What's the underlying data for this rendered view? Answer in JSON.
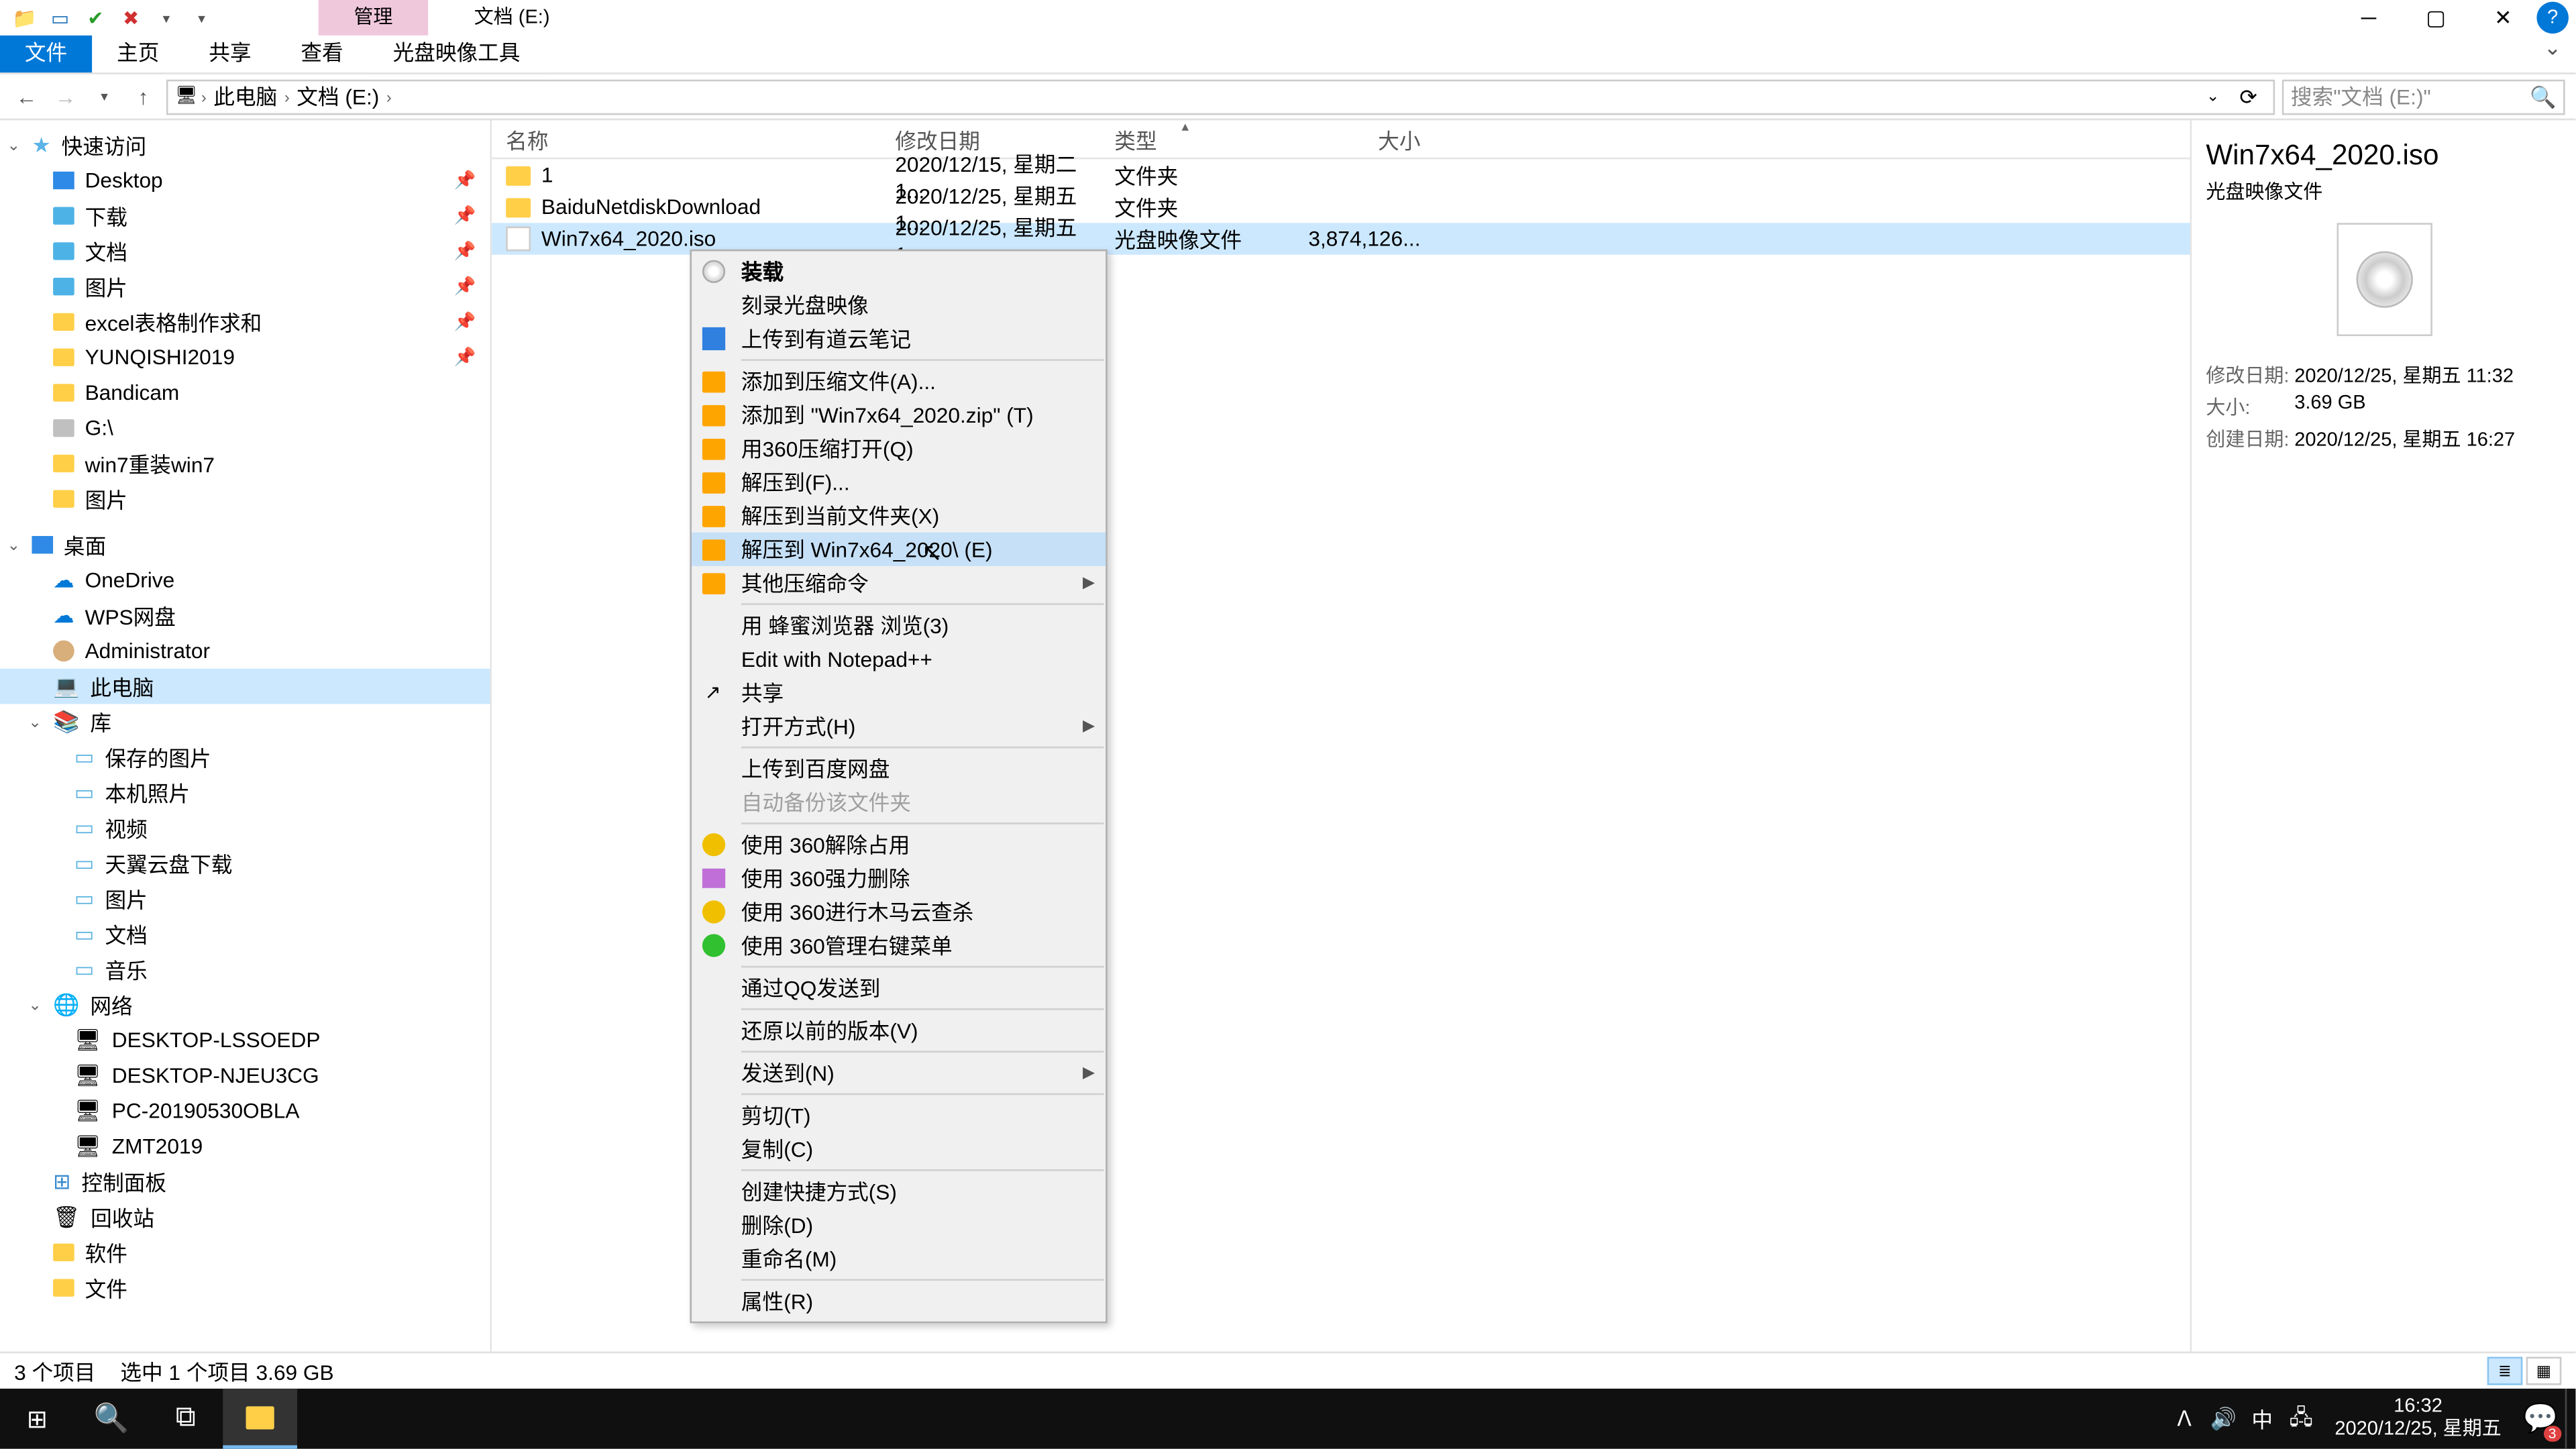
{
  "window": {
    "title": "文档 (E:)",
    "contextual_tab": "管理",
    "ribbon_tabs": [
      "文件",
      "主页",
      "共享",
      "查看",
      "光盘映像工具"
    ],
    "ribbon_selected": 0
  },
  "navigation": {
    "back_disabled": false,
    "breadcrumbs": [
      "此电脑",
      "文档 (E:)"
    ],
    "search_placeholder": "搜索\"文档 (E:)\""
  },
  "tree": {
    "quick_access": "快速访问",
    "quick_items": [
      {
        "label": "Desktop",
        "icon": "ico-desktop",
        "pinned": true
      },
      {
        "label": "下载",
        "icon": "ico-folder-blue",
        "pinned": true
      },
      {
        "label": "文档",
        "icon": "ico-folder-blue",
        "pinned": true
      },
      {
        "label": "图片",
        "icon": "ico-folder-blue",
        "pinned": true
      },
      {
        "label": "excel表格制作求和",
        "icon": "ico-folder",
        "pinned": true
      },
      {
        "label": "YUNQISHI2019",
        "icon": "ico-folder",
        "pinned": true
      },
      {
        "label": "Bandicam",
        "icon": "ico-folder",
        "pinned": false
      },
      {
        "label": "G:\\",
        "icon": "ico-disk",
        "pinned": false
      },
      {
        "label": "win7重装win7",
        "icon": "ico-folder",
        "pinned": false
      },
      {
        "label": "图片",
        "icon": "ico-folder",
        "pinned": false
      }
    ],
    "desktop": "桌面",
    "desktop_items": [
      {
        "label": "OneDrive",
        "icon": "ico-onedrive"
      },
      {
        "label": "WPS网盘",
        "icon": "ico-onedrive"
      },
      {
        "label": "Administrator",
        "icon": "ico-user"
      }
    ],
    "this_pc": "此电脑",
    "libraries": "库",
    "lib_items": [
      {
        "label": "保存的图片"
      },
      {
        "label": "本机照片"
      },
      {
        "label": "视频"
      },
      {
        "label": "天翼云盘下载"
      },
      {
        "label": "图片"
      },
      {
        "label": "文档"
      },
      {
        "label": "音乐"
      }
    ],
    "network": "网络",
    "net_items": [
      {
        "label": "DESKTOP-LSSOEDP"
      },
      {
        "label": "DESKTOP-NJEU3CG"
      },
      {
        "label": "PC-20190530OBLA"
      },
      {
        "label": "ZMT2019"
      }
    ],
    "control_panel": "控制面板",
    "recycle": "回收站",
    "software": "软件",
    "files": "文件"
  },
  "columns": {
    "name": "名称",
    "date": "修改日期",
    "type": "类型",
    "size": "大小"
  },
  "files": [
    {
      "name": "1",
      "date": "2020/12/15, 星期二 1...",
      "type": "文件夹",
      "size": "",
      "kind": "folder"
    },
    {
      "name": "BaiduNetdiskDownload",
      "date": "2020/12/25, 星期五 1...",
      "type": "文件夹",
      "size": "",
      "kind": "folder"
    },
    {
      "name": "Win7x64_2020.iso",
      "date": "2020/12/25, 星期五 1...",
      "type": "光盘映像文件",
      "size": "3,874,126...",
      "kind": "iso",
      "selected": true
    }
  ],
  "context_menu": [
    {
      "label": "装载",
      "icon": "micon-disc",
      "bold": true
    },
    {
      "label": "刻录光盘映像"
    },
    {
      "label": "上传到有道云笔记",
      "icon": "micon-note"
    },
    {
      "sep": true
    },
    {
      "label": "添加到压缩文件(A)...",
      "icon": "micon-archive"
    },
    {
      "label": "添加到 \"Win7x64_2020.zip\" (T)",
      "icon": "micon-archive"
    },
    {
      "label": "用360压缩打开(Q)",
      "icon": "micon-archive"
    },
    {
      "label": "解压到(F)...",
      "icon": "micon-archive"
    },
    {
      "label": "解压到当前文件夹(X)",
      "icon": "micon-archive"
    },
    {
      "label": "解压到 Win7x64_2020\\ (E)",
      "icon": "micon-archive",
      "highlighted": true
    },
    {
      "label": "其他压缩命令",
      "icon": "micon-archive",
      "submenu": true
    },
    {
      "sep": true
    },
    {
      "label": "用 蜂蜜浏览器 浏览(3)",
      "icon": ""
    },
    {
      "label": "Edit with Notepad++",
      "icon": ""
    },
    {
      "label": "共享",
      "icon": "micon-share"
    },
    {
      "label": "打开方式(H)",
      "submenu": true
    },
    {
      "sep": true
    },
    {
      "label": "上传到百度网盘",
      "icon": ""
    },
    {
      "label": "自动备份该文件夹",
      "disabled": true
    },
    {
      "sep": true
    },
    {
      "label": "使用 360解除占用",
      "icon": "micon-360y"
    },
    {
      "label": "使用 360强力删除",
      "icon": "micon-delete"
    },
    {
      "label": "使用 360进行木马云查杀",
      "icon": "micon-360y"
    },
    {
      "label": "使用 360管理右键菜单",
      "icon": "micon-360"
    },
    {
      "sep": true
    },
    {
      "label": "通过QQ发送到"
    },
    {
      "sep": true
    },
    {
      "label": "还原以前的版本(V)"
    },
    {
      "sep": true
    },
    {
      "label": "发送到(N)",
      "submenu": true
    },
    {
      "sep": true
    },
    {
      "label": "剪切(T)"
    },
    {
      "label": "复制(C)"
    },
    {
      "sep": true
    },
    {
      "label": "创建快捷方式(S)"
    },
    {
      "label": "删除(D)"
    },
    {
      "label": "重命名(M)"
    },
    {
      "sep": true
    },
    {
      "label": "属性(R)"
    }
  ],
  "preview": {
    "title": "Win7x64_2020.iso",
    "type": "光盘映像文件",
    "fields": [
      {
        "label": "修改日期:",
        "value": "2020/12/25, 星期五 11:32"
      },
      {
        "label": "大小:",
        "value": "3.69 GB"
      },
      {
        "label": "创建日期:",
        "value": "2020/12/25, 星期五 16:27"
      }
    ]
  },
  "status": {
    "items": "3 个项目",
    "selected": "选中 1 个项目  3.69 GB"
  },
  "taskbar": {
    "ime": "中",
    "time": "16:32",
    "date": "2020/12/25, 星期五",
    "notif_count": "3"
  }
}
